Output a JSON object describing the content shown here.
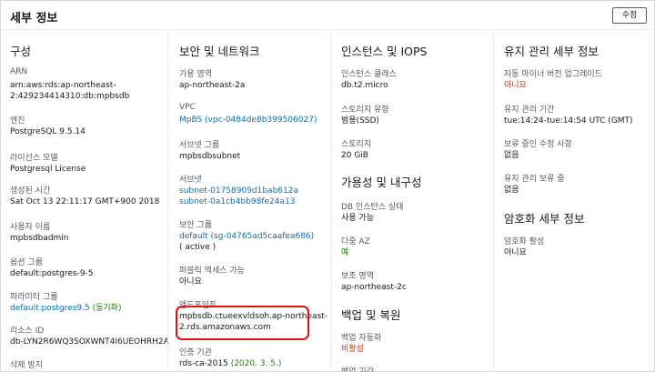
{
  "header": {
    "title": "세부 정보",
    "edit_label": "수정"
  },
  "config": {
    "heading": "구성",
    "arn_label": "ARN",
    "arn_line1": "arn:aws:rds:ap-northeast-",
    "arn_line2": "2:429234414310:db:mpbsdb",
    "engine_label": "엔진",
    "engine_value": "PostgreSQL 9.5.14",
    "license_label": "라이선스 모델",
    "license_value": "Postgresql License",
    "created_label": "생성된 시간",
    "created_value": "Sat Oct 13 22:11:17 GMT+900 2018",
    "user_label": "사용자 이름",
    "user_value": "mpbsdbadmin",
    "option_label": "옵션 그룹",
    "option_value": "default:postgres-9-5",
    "param_label": "파라미터 그룹",
    "param_value": "default.postgres9.5",
    "param_status": "(동기화)",
    "resource_label": "리소스 ID",
    "resource_value": "db-LYN2R6WQ3SOXWNT4I6UEOHRH2A",
    "delete_label": "삭제 방지"
  },
  "security": {
    "heading": "보안 및 네트워크",
    "az_label": "가용 영역",
    "az_value": "ap-northeast-2a",
    "vpc_label": "VPC",
    "vpc_value": "MpBS (vpc-0484de8b399506027)",
    "subnet_group_label": "서브넷 그룹",
    "subnet_group_value": "mpbsdbsubnet",
    "subnets_label": "서브넷",
    "subnet1": "subnet-01758909d1bab612a",
    "subnet2": "subnet-0a1cb4bb98fe24a13",
    "sg_label": "보안 그룹",
    "sg_value": "default (sg-04765ad5caafea686)",
    "sg_status": "( active )",
    "public_label": "퍼블릭 액세스 가능",
    "public_value": "아니요",
    "endpoint_label": "엔드포인트",
    "endpoint_line1": "mpbsdb.ctueexvldsoh.ap-northeast-",
    "endpoint_line2": "2.rds.amazonaws.com",
    "ca_label": "인증 기관",
    "ca_value": "rds-ca-2015",
    "ca_date": "(2020. 3. 5.)"
  },
  "instance": {
    "heading": "인스턴스 및 IOPS",
    "class_label": "인스턴스 클래스",
    "class_value": "db.t2.micro",
    "storage_type_label": "스토리지 유형",
    "storage_type_value": "범용(SSD)",
    "storage_label": "스토리지",
    "storage_value": "20 GiB",
    "durability_heading": "가용성 및 내구성",
    "status_label": "DB 인스턴스 상태",
    "status_value": "사용 가능",
    "multiaz_label": "다중 AZ",
    "multiaz_value": "예",
    "secondary_label": "보조 영역",
    "secondary_value": "ap-northeast-2c",
    "backup_heading": "백업 및 복원",
    "auto_backup_label": "백업 자동화",
    "auto_backup_value": "비활성",
    "backup_period_label": "백업 기간"
  },
  "maintenance": {
    "heading": "유지 관리 세부 정보",
    "minor_label": "자동 마이너 버전 업그레이드",
    "minor_value": "아니요",
    "window_label": "유지 관리 기간",
    "window_value": "tue:14:24-tue:14:54 UTC (GMT)",
    "pending_label": "보류 중인 수정 사항",
    "pending_value": "없음",
    "pending_maint_label": "유지 관리 보류 중",
    "pending_maint_value": "없음",
    "encryption_heading": "암호화 세부 정보",
    "encryption_label": "암호화 활성",
    "encryption_value": "아니요"
  }
}
